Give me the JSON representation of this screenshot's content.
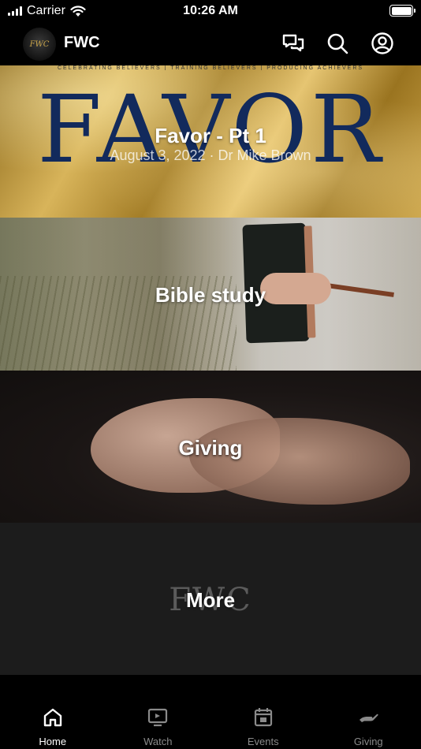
{
  "status_bar": {
    "carrier": "Carrier",
    "time": "10:26 AM"
  },
  "header": {
    "logo_text": "FWC",
    "title": "FWC",
    "icons": [
      "chat-icon",
      "search-icon",
      "profile-icon"
    ]
  },
  "tiles": [
    {
      "title": "Favor - Pt 1",
      "subtitle": "August 3, 2022 · Dr Mike Brown",
      "artwork_text": "FAVOR",
      "artwork_tagline": "CELEBRATING BELIEVERS  |  TRAINING BELIEVERS  |  PRODUCING ACHIEVERS"
    },
    {
      "title": "Bible study"
    },
    {
      "title": "Giving"
    },
    {
      "title": "More",
      "watermark": "FWC"
    }
  ],
  "tab_bar": {
    "tabs": [
      {
        "label": "Home",
        "icon": "home-icon",
        "active": true
      },
      {
        "label": "Watch",
        "icon": "tv-icon",
        "active": false
      },
      {
        "label": "Events",
        "icon": "calendar-icon",
        "active": false
      },
      {
        "label": "Giving",
        "icon": "giving-hand-icon",
        "active": false
      }
    ]
  },
  "colors": {
    "background": "#000000",
    "favor_navy": "#122a5c",
    "gold": "#c9a247",
    "tab_inactive": "#8a8a8a"
  }
}
